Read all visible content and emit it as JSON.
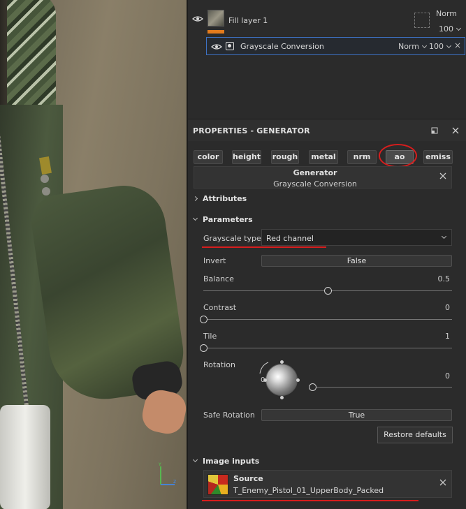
{
  "layers": {
    "fill_layer": {
      "name": "Fill layer 1",
      "blend": "Norm",
      "opacity": "100"
    },
    "effect": {
      "name": "Grayscale Conversion",
      "blend": "Norm",
      "opacity": "100",
      "close": "×"
    }
  },
  "properties": {
    "title": "PROPERTIES - GENERATOR",
    "channels": [
      "color",
      "height",
      "rough",
      "metal",
      "nrm",
      "ao",
      "emiss"
    ],
    "active_channel": "ao",
    "generator": {
      "title": "Generator",
      "name": "Grayscale Conversion"
    },
    "sections": {
      "attributes": "Attributes",
      "parameters": "Parameters",
      "image_inputs": "Image inputs"
    },
    "params": {
      "grayscale_type": {
        "label": "Grayscale type",
        "value": "Red channel"
      },
      "invert": {
        "label": "Invert",
        "value": "False"
      },
      "balance": {
        "label": "Balance",
        "value": "0.5",
        "fraction": 0.5
      },
      "contrast": {
        "label": "Contrast",
        "value": "0",
        "fraction": 0
      },
      "tile": {
        "label": "Tile",
        "value": "1",
        "fraction": 0
      },
      "rotation": {
        "label": "Rotation",
        "value": "0",
        "dial_label": "0",
        "fraction": 0
      },
      "safe_rotation": {
        "label": "Safe Rotation",
        "value": "True"
      }
    },
    "restore_defaults": "Restore defaults",
    "source": {
      "title": "Source",
      "file": "T_Enemy_Pistol_01_UpperBody_Packed"
    }
  },
  "colors": {
    "accent": "#3e72c4",
    "annotation": "#d71d1d",
    "orange": "#e37b1c"
  }
}
